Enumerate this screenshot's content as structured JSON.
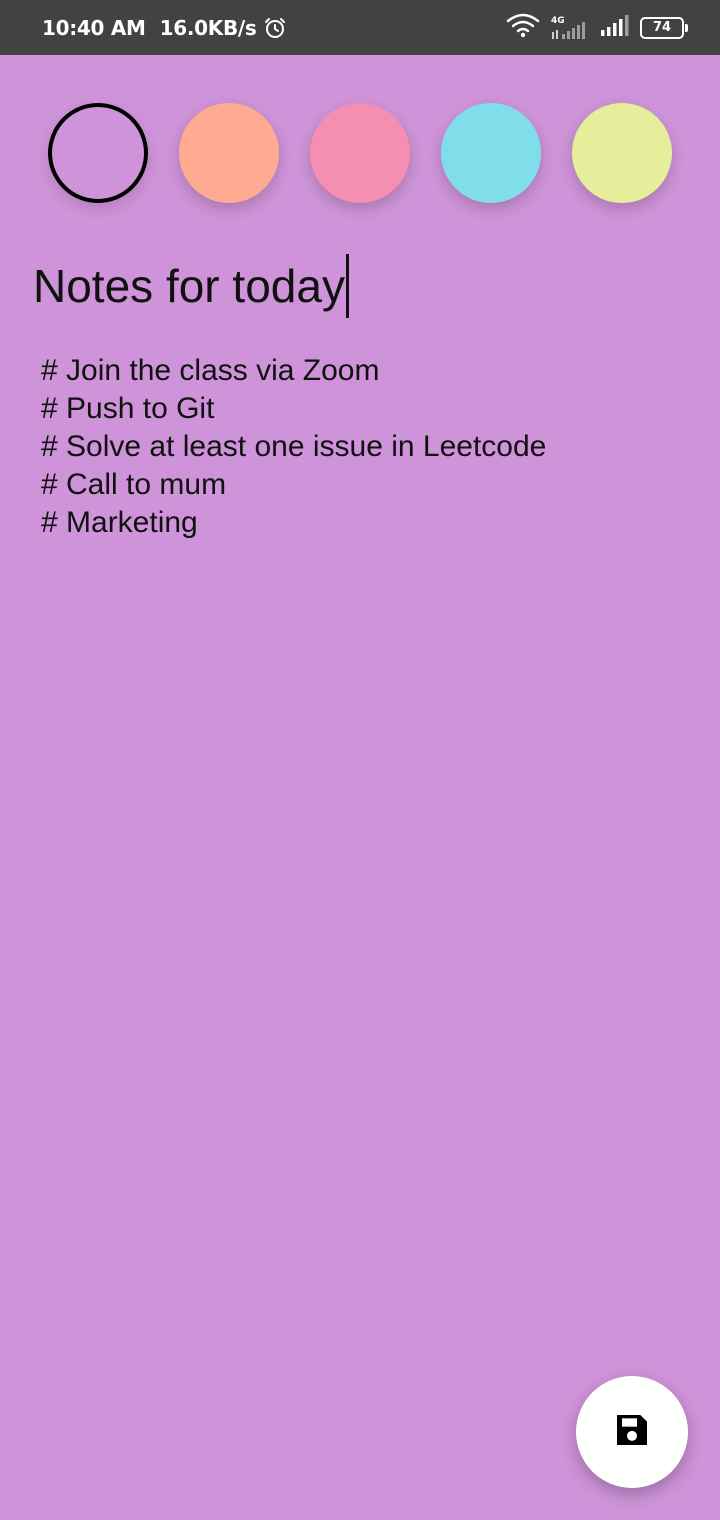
{
  "status_bar": {
    "time": "10:40 AM",
    "network_speed": "16.0KB/s",
    "network_type": "4G",
    "battery": "74",
    "icons": [
      "alarm-icon",
      "wifi-icon",
      "signal-4g-icon",
      "signal-icon",
      "battery-icon"
    ]
  },
  "color_picker": {
    "options": [
      "#CE93D8",
      "#FFAB91",
      "#F48FB1",
      "#80DEEA",
      "#E6EE9C"
    ],
    "selected_index": 0
  },
  "note": {
    "title": "Notes for today",
    "body_lines": [
      "# Join the class via Zoom",
      "# Push to Git",
      "# Solve at least one issue in Leetcode",
      "# Call to mum",
      "# Marketing"
    ]
  },
  "fab": {
    "icon": "save-icon"
  },
  "colors": {
    "background": "#CE93D8",
    "status_bar": "#424242"
  }
}
